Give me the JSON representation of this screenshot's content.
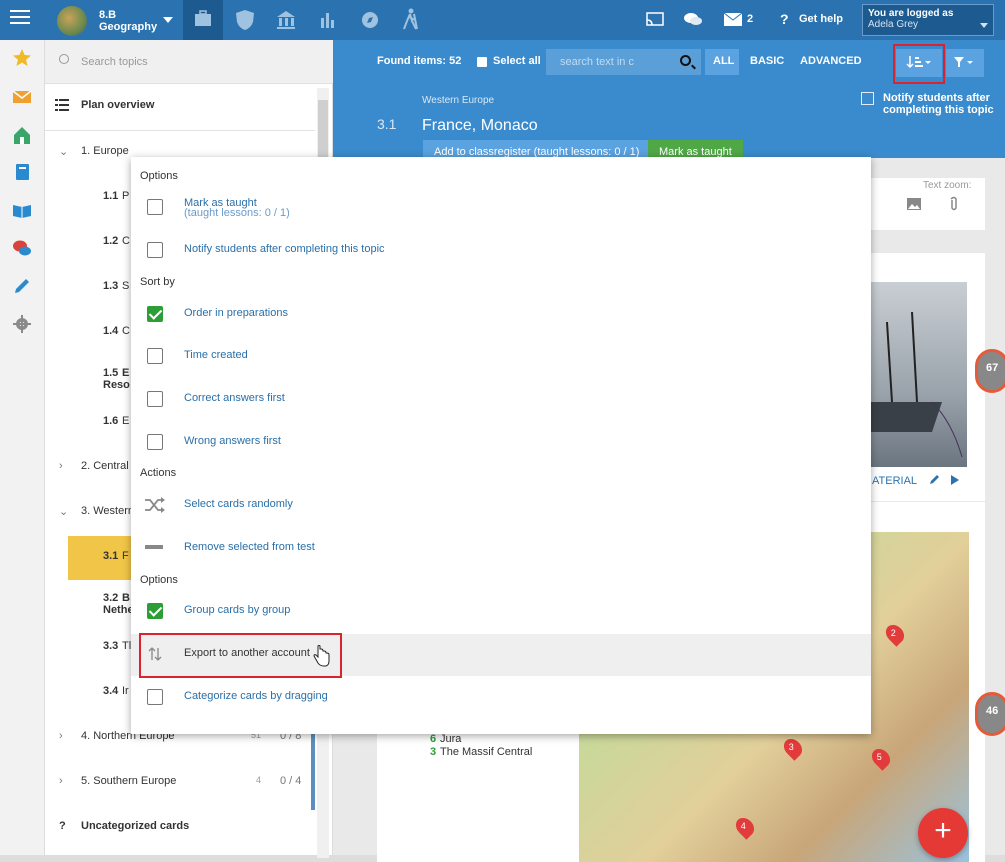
{
  "header": {
    "class_name": "8.B",
    "subject": "Geography",
    "messages_count": "2",
    "get_help": "Get help",
    "logged_label": "You are logged as",
    "user_name": "Adela Grey"
  },
  "sidebar": {
    "search_placeholder": "Search topics",
    "plan_overview": "Plan overview",
    "items": [
      {
        "label": "1. Europe"
      },
      {
        "num": "1.1",
        "label": "P"
      },
      {
        "num": "1.2",
        "label": "C"
      },
      {
        "num": "1.3",
        "label": "S"
      },
      {
        "num": "1.4",
        "label": "C"
      },
      {
        "num": "1.5",
        "label": "E",
        "label2": "Reso"
      },
      {
        "num": "1.6",
        "label": "E"
      },
      {
        "label": "2. Central"
      },
      {
        "label": "3. Western"
      },
      {
        "num": "3.1",
        "label": "F"
      },
      {
        "num": "3.2",
        "label": "B",
        "label2": "Nethe"
      },
      {
        "num": "3.3",
        "label": "Tl"
      },
      {
        "num": "3.4",
        "label": "Ir"
      },
      {
        "label": "4. Northern Europe",
        "count": "51",
        "progress": "0 / 8"
      },
      {
        "label": "5. Southern Europe",
        "count": "4",
        "progress": "0 / 4"
      }
    ],
    "uncategorized_mark": "?",
    "uncategorized": "Uncategorized cards"
  },
  "main": {
    "found_items": "Found items: 52",
    "select_all": "Select all",
    "search_placeholder": "search text in c",
    "filter_all": "ALL",
    "filter_basic": "BASIC",
    "filter_advanced": "ADVANCED",
    "notify_line1": "Notify students after",
    "notify_line2": "completing this topic",
    "topic_region": "Western Europe",
    "topic_num": "3.1",
    "topic_title": "France, Monaco",
    "add_classregister": "Add to classregister (taught lessons: 0 / 1)",
    "mark_as_taught": "Mark as taught",
    "text_zoom": "Text zoom:",
    "material": "ATERIAL",
    "pct1": "67",
    "pct2": "46",
    "map_list": [
      {
        "num": "6",
        "label": "Jura"
      },
      {
        "num": "3",
        "label": "The Massif Central"
      }
    ],
    "pins": [
      "2",
      "3",
      "5",
      "4"
    ]
  },
  "dropdown": {
    "section_options": "Options",
    "mark_taught": "Mark as taught",
    "mark_taught_sub": "(taught lessons: 0 / 1)",
    "notify": "Notify students after completing this topic",
    "section_sort": "Sort by",
    "order_prep": "Order in preparations",
    "time_created": "Time created",
    "correct_first": "Correct answers first",
    "wrong_first": "Wrong answers first",
    "section_actions": "Actions",
    "select_random": "Select cards randomly",
    "remove_selected": "Remove selected from test",
    "section_options2": "Options",
    "group_cards": "Group cards by group",
    "export": "Export to another account",
    "categorize": "Categorize cards by dragging"
  },
  "colors": {
    "header_blue": "#2a73b0",
    "main_blue": "#3a8bcd",
    "accent_green": "#2d9d37",
    "highlight_red": "#d9232e",
    "active_topic": "#f1c648"
  }
}
